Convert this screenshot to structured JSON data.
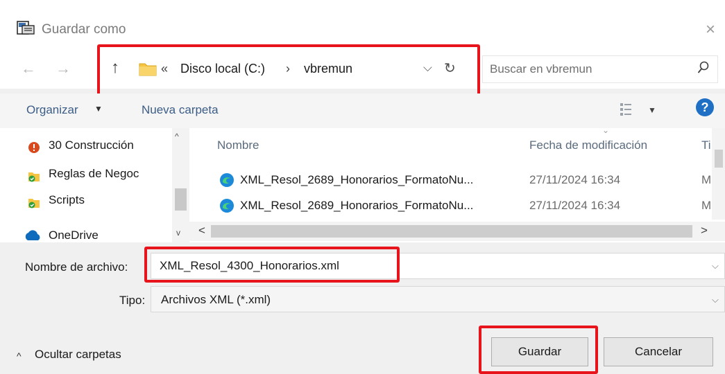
{
  "dialog": {
    "title": "Guardar como",
    "close_glyph": "×"
  },
  "nav": {
    "back_glyph": "←",
    "forward_glyph": "→",
    "up_glyph": "↑",
    "breadcrumb_overflow": "«",
    "breadcrumb_separator": "›",
    "breadcrumb": [
      "Disco local (C:)",
      "vbremun"
    ],
    "dropdown_glyph": "⌵",
    "refresh_glyph": "↻",
    "search_placeholder": "Buscar en vbremun"
  },
  "toolbar": {
    "organize_label": "Organizar",
    "organize_caret": "▼",
    "new_folder_label": "Nueva carpeta",
    "view_caret": "▼",
    "help_glyph": "?"
  },
  "tree": {
    "items": [
      {
        "label": "30 Construcción",
        "icon": "folder-warning-icon"
      },
      {
        "label": "Reglas de Negoc",
        "icon": "folder-sync-icon"
      },
      {
        "label": "Scripts",
        "icon": "folder-sync-icon"
      },
      {
        "label": "OneDrive",
        "icon": "cloud-icon"
      }
    ],
    "scroll_up_glyph": "^",
    "scroll_down_glyph": "v"
  },
  "filelist": {
    "columns": [
      "Nombre",
      "Fecha de modificación",
      "Ti"
    ],
    "sort_glyph": "⌄",
    "rows": [
      {
        "name": "XML_Resol_2689_Honorarios_FormatoNu...",
        "date": "27/11/2024 16:34",
        "type": "M"
      },
      {
        "name": "XML_Resol_2689_Honorarios_FormatoNu...",
        "date": "27/11/2024 16:34",
        "type": "M"
      }
    ],
    "hscroll_left_glyph": "<",
    "hscroll_right_glyph": ">"
  },
  "form": {
    "filename_label": "Nombre de archivo:",
    "filename_value": "XML_Resol_4300_Honorarios.xml",
    "type_label": "Tipo:",
    "type_value": "Archivos XML (*.xml)",
    "combo_caret": "⌵"
  },
  "footer": {
    "hide_folders_caret": "^",
    "hide_folders_label": "Ocultar carpetas",
    "save_label": "Guardar",
    "cancel_label": "Cancelar"
  },
  "colors": {
    "highlight": "#e8141c",
    "link": "#3b5d86",
    "help": "#1f6fc5"
  }
}
